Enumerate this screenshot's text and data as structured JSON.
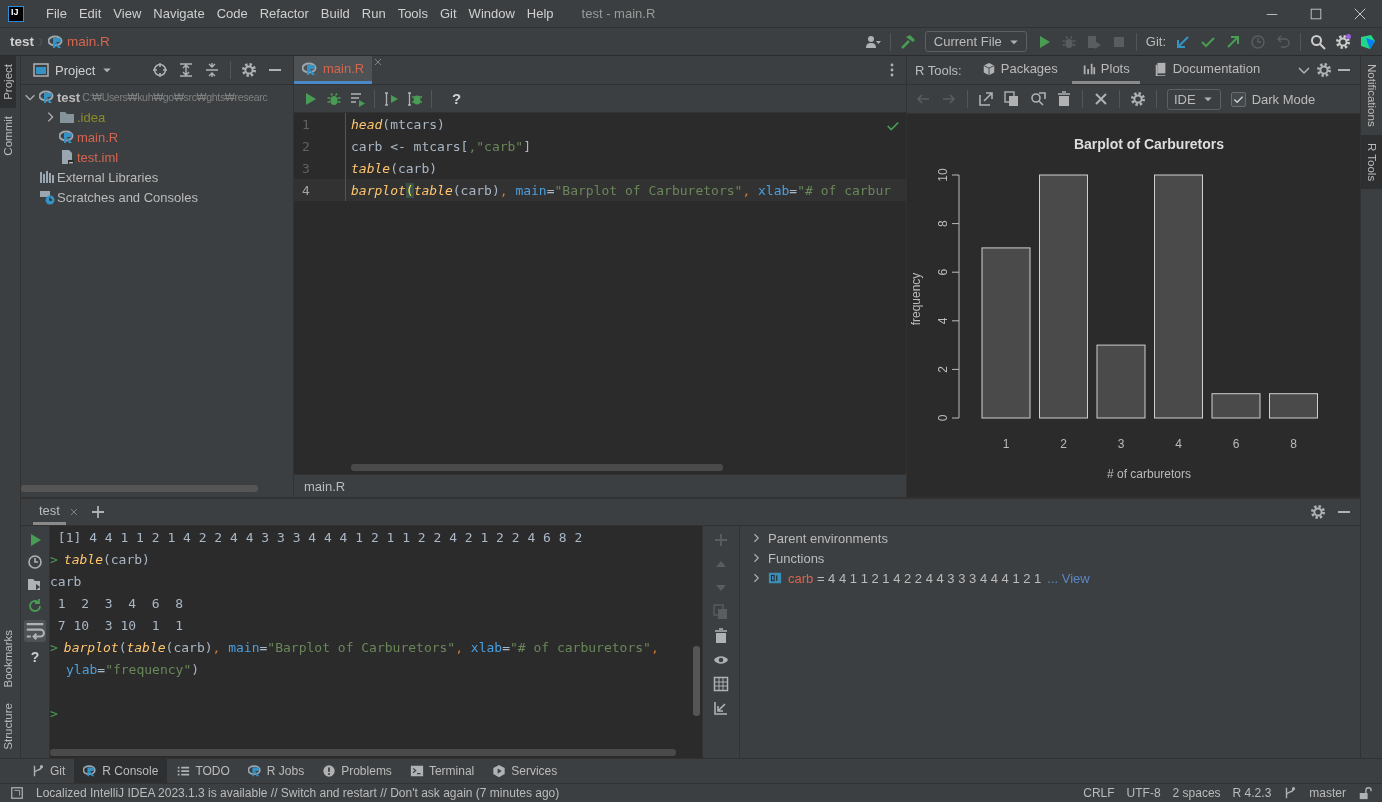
{
  "window": {
    "logo": "IJ",
    "menu": [
      "File",
      "Edit",
      "View",
      "Navigate",
      "Code",
      "Refactor",
      "Build",
      "Run",
      "Tools",
      "Git",
      "Window",
      "Help"
    ],
    "title": "test - main.R"
  },
  "breadcrumb": [
    "test",
    "main.R"
  ],
  "toolbar": {
    "run_config": "Current File",
    "git_label": "Git:"
  },
  "left_stripe": [
    {
      "label": "Project",
      "selected": true
    },
    {
      "label": "Commit",
      "selected": false
    }
  ],
  "left_stripe_bottom": [
    "Bookmarks",
    "Structure"
  ],
  "right_stripe": [
    {
      "label": "Notifications",
      "selected": false
    },
    {
      "label": "R Tools",
      "selected": true
    }
  ],
  "project": {
    "title": "Project",
    "tree": [
      {
        "name": "test",
        "path": "C:₩Users₩kuh₩go₩src₩ghts₩researc",
        "kind": "module",
        "color": "#bbbbbb",
        "expanded": true,
        "children": [
          {
            "name": ".idea",
            "kind": "folder",
            "color": "#8c8c27",
            "expanded": false
          },
          {
            "name": "main.R",
            "kind": "rfile",
            "color": "#d6654f"
          },
          {
            "name": "test.iml",
            "kind": "iml",
            "color": "#d6654f"
          }
        ]
      },
      {
        "name": "External Libraries",
        "kind": "libraries",
        "color": "#bbbbbb"
      },
      {
        "name": "Scratches and Consoles",
        "kind": "scratches",
        "color": "#bbbbbb"
      }
    ]
  },
  "editor": {
    "tab": {
      "label": "main.R",
      "selected": true
    },
    "help": "?",
    "footer": "main.R",
    "lines": [
      {
        "number": "1",
        "current": false,
        "tokens": [
          {
            "text": "head",
            "kind": "fn"
          },
          {
            "text": "(mtcars)",
            "kind": "plain"
          }
        ]
      },
      {
        "number": "2",
        "current": false,
        "tokens": [
          {
            "text": "carb <- mtcars[",
            "kind": "plain"
          },
          {
            "text": ",\"carb\"",
            "kind": "str"
          },
          {
            "text": "]",
            "kind": "plain"
          }
        ]
      },
      {
        "number": "3",
        "current": false,
        "tokens": [
          {
            "text": "table",
            "kind": "fn"
          },
          {
            "text": "(carb)",
            "kind": "plain"
          }
        ]
      },
      {
        "number": "4",
        "current": true,
        "tokens": [
          {
            "text": "barplot",
            "kind": "fn"
          },
          {
            "text": "(",
            "kind": "match"
          },
          {
            "text": "table",
            "kind": "fn"
          },
          {
            "text": "(carb)",
            "kind": "plain"
          },
          {
            "text": ", ",
            "kind": "punct"
          },
          {
            "text": "main",
            "kind": "arg"
          },
          {
            "text": "=",
            "kind": "plain"
          },
          {
            "text": "\"Barplot of Carburetors\"",
            "kind": "str"
          },
          {
            "text": ", ",
            "kind": "punct"
          },
          {
            "text": "xlab",
            "kind": "arg"
          },
          {
            "text": "=",
            "kind": "plain"
          },
          {
            "text": "\"# of carbur",
            "kind": "str"
          }
        ]
      }
    ]
  },
  "rtools": {
    "label": "R Tools:",
    "tabs": [
      {
        "label": "Packages",
        "selected": false
      },
      {
        "label": "Plots",
        "selected": true
      },
      {
        "label": "Documentation",
        "selected": false
      }
    ],
    "device": "IDE",
    "dark_mode": {
      "label": "Dark Mode",
      "checked": true
    },
    "chart_data": {
      "type": "bar",
      "title": "Barplot of Carburetors",
      "xlabel": "# of carburetors",
      "ylabel": "frequency",
      "categories": [
        "1",
        "2",
        "3",
        "4",
        "6",
        "8"
      ],
      "values": [
        7,
        10,
        3,
        10,
        1,
        1
      ],
      "ylim": [
        0,
        10
      ],
      "yticks": [
        0,
        2,
        4,
        6,
        8,
        10
      ]
    }
  },
  "console": {
    "tab": {
      "label": "test",
      "selected": true
    },
    "help": "?",
    "lines": [
      {
        "kind": "output",
        "tokens": [
          {
            "text": " [1] 4 4 1 1 2 1 4 2 2 4 4 3 3 3 4 4 4 1 2 1 1 2 2 4 2 1 2 2 4 6 8 2",
            "kind": "plain"
          }
        ]
      },
      {
        "kind": "input",
        "prompt": ">",
        "tokens": [
          {
            "text": "table",
            "kind": "fn"
          },
          {
            "text": "(carb)",
            "kind": "plain"
          }
        ]
      },
      {
        "kind": "output",
        "tokens": [
          {
            "text": "carb",
            "kind": "plain"
          }
        ]
      },
      {
        "kind": "output",
        "tokens": [
          {
            "text": " 1  2  3  4  6  8",
            "kind": "plain"
          }
        ]
      },
      {
        "kind": "output",
        "tokens": [
          {
            "text": " 7 10  3 10  1  1",
            "kind": "plain"
          }
        ]
      },
      {
        "kind": "input",
        "prompt": ">",
        "tokens": [
          {
            "text": "barplot",
            "kind": "fn"
          },
          {
            "text": "(",
            "kind": "plain"
          },
          {
            "text": "table",
            "kind": "fn"
          },
          {
            "text": "(carb)",
            "kind": "plain"
          },
          {
            "text": ", ",
            "kind": "punct"
          },
          {
            "text": "main",
            "kind": "arg"
          },
          {
            "text": "=",
            "kind": "plain"
          },
          {
            "text": "\"Barplot of Carburetors\"",
            "kind": "str"
          },
          {
            "text": ", ",
            "kind": "punct"
          },
          {
            "text": "xlab",
            "kind": "arg"
          },
          {
            "text": "=",
            "kind": "plain"
          },
          {
            "text": "\"# of carburetors\"",
            "kind": "str"
          },
          {
            "text": ",",
            "kind": "punct"
          }
        ]
      },
      {
        "kind": "continuation",
        "tokens": [
          {
            "text": "ylab",
            "kind": "arg"
          },
          {
            "text": "=",
            "kind": "plain"
          },
          {
            "text": "\"frequency\"",
            "kind": "str"
          },
          {
            "text": ")",
            "kind": "plain"
          }
        ]
      },
      {
        "kind": "blank"
      },
      {
        "kind": "input",
        "prompt": ">"
      }
    ]
  },
  "variables": [
    {
      "kind": "group",
      "name": "Parent environments"
    },
    {
      "kind": "group",
      "name": "Functions"
    },
    {
      "kind": "variable",
      "name": "carb",
      "value": " = 4 4 1 1 2 1 4 2 2 4 4 3 3 3 4 4 4 1 2 1",
      "link": "... View"
    }
  ],
  "tool_tabs": [
    {
      "label": "Git",
      "kind": "git",
      "selected": false
    },
    {
      "label": "R Console",
      "kind": "r",
      "selected": true
    },
    {
      "label": "TODO",
      "kind": "list",
      "selected": false
    },
    {
      "label": "R Jobs",
      "kind": "r",
      "selected": false
    },
    {
      "label": "Problems",
      "kind": "problems",
      "selected": false
    },
    {
      "label": "Terminal",
      "kind": "terminal",
      "selected": false
    },
    {
      "label": "Services",
      "kind": "services",
      "selected": false
    }
  ],
  "status_bar": {
    "message": "Localized IntelliJ IDEA 2023.1.3 is available // Switch and restart // Don't ask again (7 minutes ago)",
    "items": [
      "CRLF",
      "UTF-8",
      "2 spaces",
      "R 4.2.3"
    ],
    "branch": "master"
  }
}
